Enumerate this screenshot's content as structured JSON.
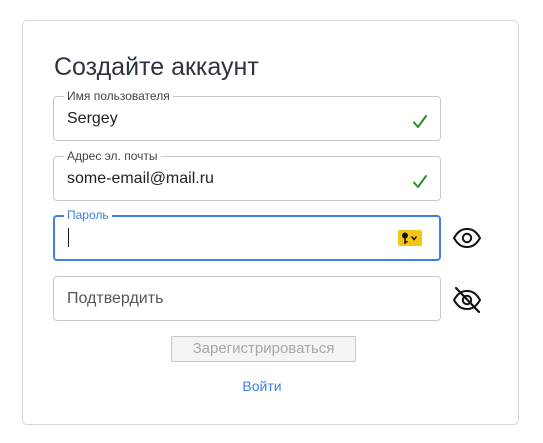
{
  "form": {
    "title": "Создайте аккаунт",
    "username": {
      "label": "Имя пользователя",
      "value": "Sergey",
      "valid": true
    },
    "email": {
      "label": "Адрес эл. почты",
      "value": "some-email@mail.ru",
      "valid": true
    },
    "password": {
      "label": "Пароль",
      "value": "",
      "focused": true
    },
    "confirm": {
      "placeholder": "Подтвердить",
      "value": ""
    },
    "submit_label": "Зарегистрироваться",
    "login_link": "Войти"
  },
  "icons": {
    "check": "check-icon",
    "key": "key-icon",
    "eye": "eye-icon",
    "eye_off": "eye-off-icon"
  },
  "colors": {
    "accent": "#3f7fe6",
    "valid": "#2e8b2e",
    "title": "#2b3440",
    "keybadge": "#f5c518",
    "disabled_text": "#a8a8a8"
  }
}
